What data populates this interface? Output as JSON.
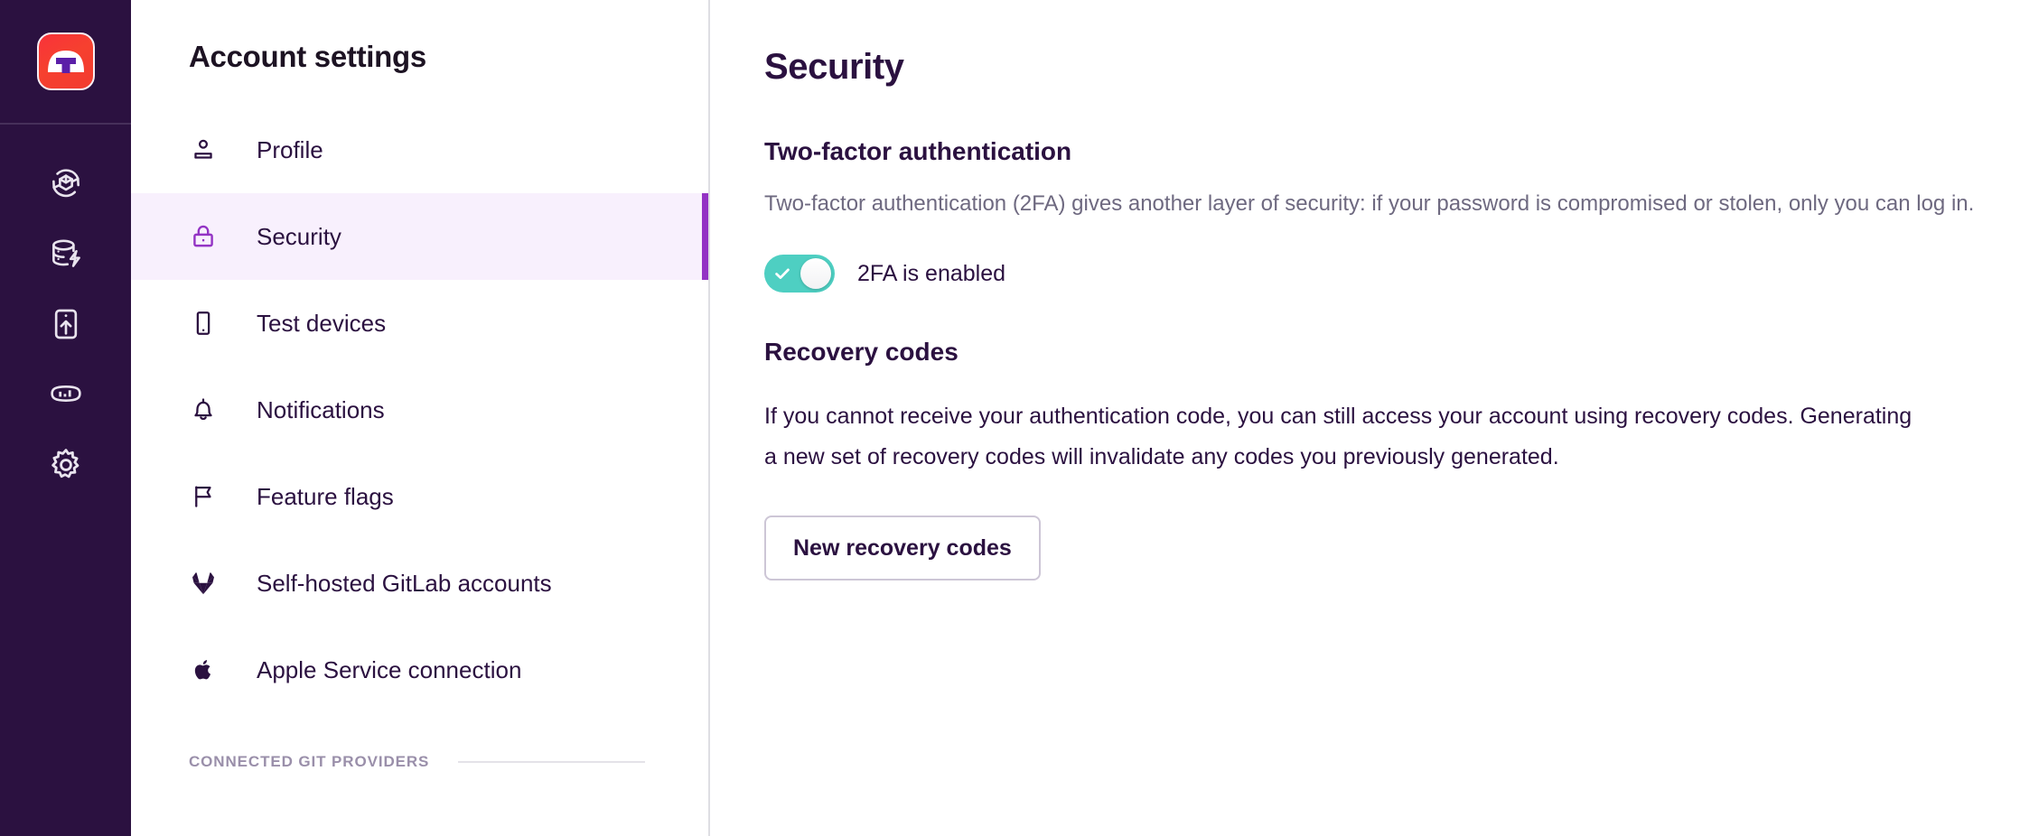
{
  "rail": {
    "logo": {
      "name": "app-logo",
      "bg_color": "#F6402F",
      "mark_color": "#5B1FA8"
    },
    "items": [
      {
        "icon": "deploy-cube-refresh-icon",
        "label": "Deployments"
      },
      {
        "icon": "database-lightning-icon",
        "label": "Data"
      },
      {
        "icon": "app-upload-icon",
        "label": "Releases"
      },
      {
        "icon": "analytics-chart-icon",
        "label": "Analytics"
      },
      {
        "icon": "gear-icon",
        "label": "Settings"
      }
    ]
  },
  "nav": {
    "title": "Account settings",
    "items": [
      {
        "icon": "person-icon",
        "label": "Profile",
        "active": false
      },
      {
        "icon": "lock-icon",
        "label": "Security",
        "active": true
      },
      {
        "icon": "phone-icon",
        "label": "Test devices",
        "active": false
      },
      {
        "icon": "bell-icon",
        "label": "Notifications",
        "active": false
      },
      {
        "icon": "flag-icon",
        "label": "Feature flags",
        "active": false
      },
      {
        "icon": "gitlab-icon",
        "label": "Self-hosted GitLab accounts",
        "active": false
      },
      {
        "icon": "apple-icon",
        "label": "Apple Service connection",
        "active": false
      }
    ],
    "section_label": "CONNECTED GIT PROVIDERS",
    "active_accent": "#9333c4",
    "active_bg": "#f8f0fd"
  },
  "main": {
    "page_title": "Security",
    "twofa": {
      "heading": "Two-factor authentication",
      "description": "Two-factor authentication (2FA) gives another layer of security: if your password is compromised or stolen, only you can log in.",
      "toggle_state": "on",
      "toggle_color": "#4ecfc2",
      "toggle_label": "2FA is enabled"
    },
    "recovery": {
      "heading": "Recovery codes",
      "description": "If you cannot receive your authentication code, you can still access your account using recovery codes. Generating a new set of recovery codes will invalidate any codes you previously generated.",
      "button_label": "New recovery codes"
    }
  }
}
